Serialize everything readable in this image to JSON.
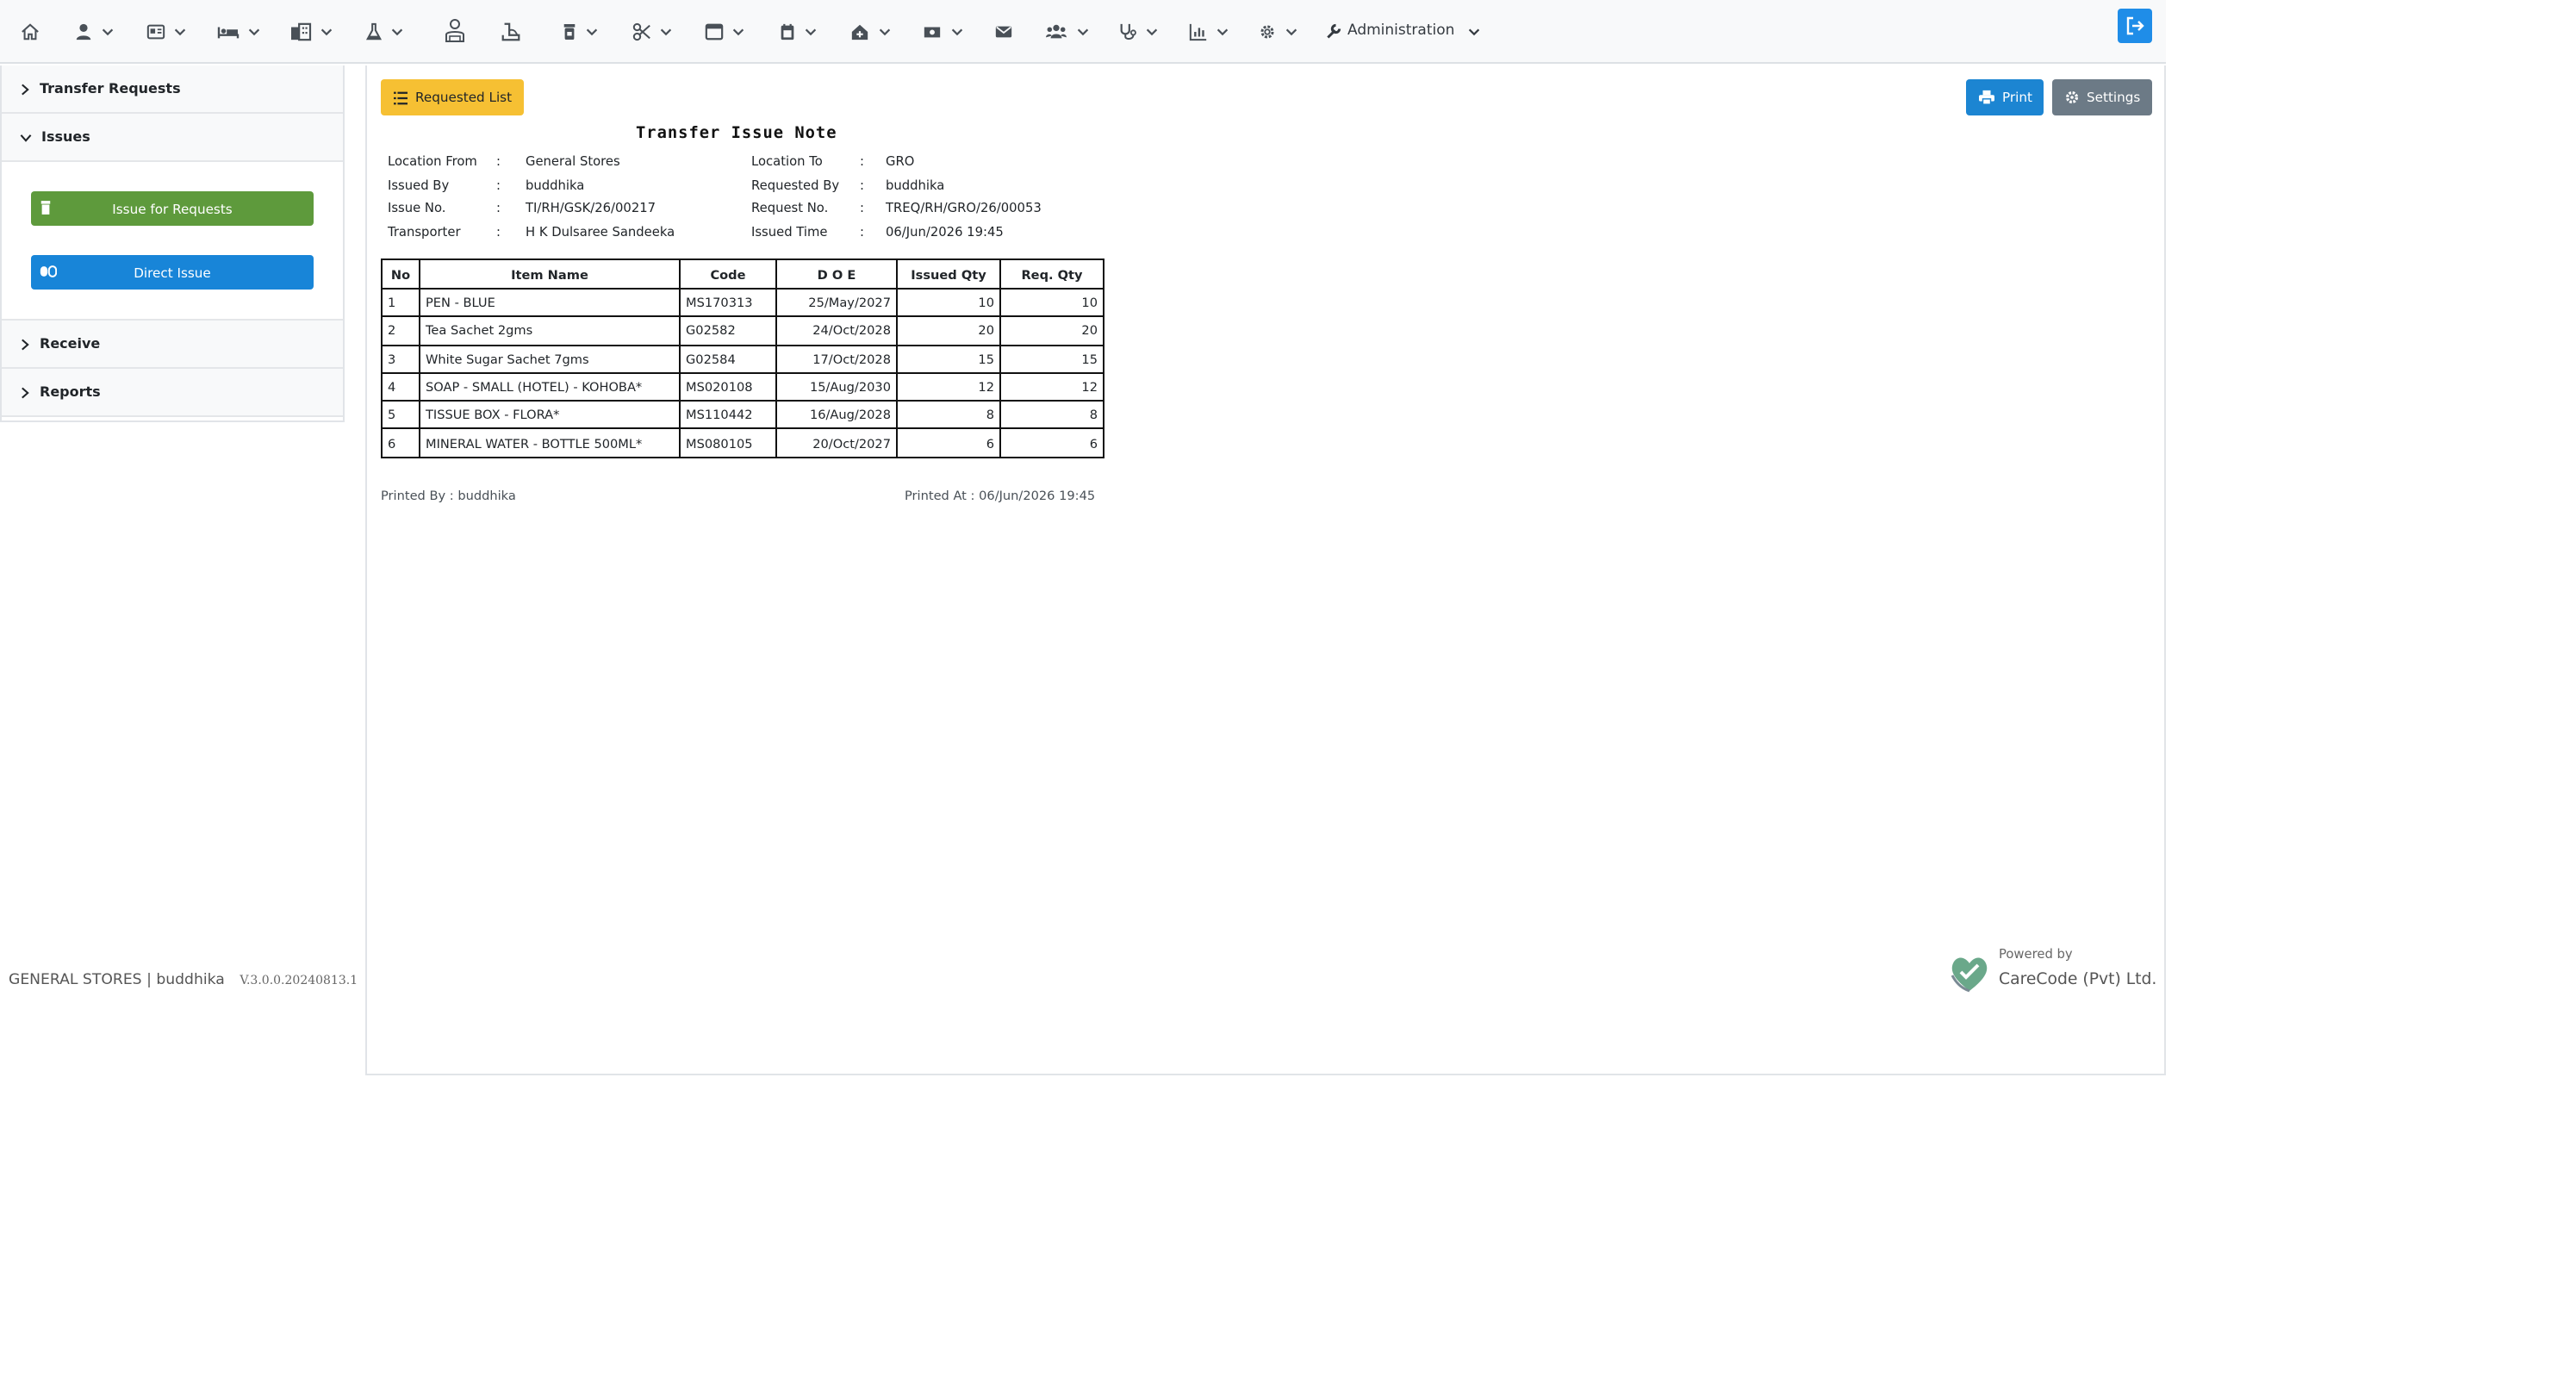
{
  "navbar": {
    "icons": [
      "home-icon",
      "user-icon",
      "id-card-icon",
      "bed-icon",
      "building-icon",
      "flask-icon",
      "doctor-icon",
      "pharmacy-icon",
      "pill-bottle-icon",
      "scissors-icon",
      "inbox-icon",
      "calendar-icon",
      "house-medical-icon",
      "cash-icon",
      "envelope-icon",
      "users-icon",
      "stethoscope-icon",
      "chart-icon",
      "gear-icon"
    ],
    "administration_label": "Administration",
    "logout_icon": "sign-out-icon"
  },
  "sidebar": {
    "sections": [
      {
        "label": "Transfer Requests",
        "expanded": false
      },
      {
        "label": "Issues",
        "expanded": true
      },
      {
        "label": "Receive",
        "expanded": false
      },
      {
        "label": "Reports",
        "expanded": false
      }
    ],
    "issue_for_requests_label": "Issue for Requests",
    "direct_issue_label": "Direct Issue",
    "colors": {
      "issue_for_requests": "#5e9a3c",
      "direct_issue": "#1885d8"
    }
  },
  "toolbar": {
    "requested_list_label": "Requested List",
    "print_label": "Print",
    "settings_label": "Settings"
  },
  "document": {
    "title": "Transfer Issue Note",
    "left_fields": [
      {
        "label": "Location From",
        "value": "General Stores"
      },
      {
        "label": "Issued By",
        "value": "buddhika"
      },
      {
        "label": "Issue No.",
        "value": "TI/RH/GSK/26/00217"
      },
      {
        "label": "Transporter",
        "value": "H K Dulsaree Sandeeka"
      }
    ],
    "right_fields": [
      {
        "label": "Location To",
        "value": "GRO"
      },
      {
        "label": "Requested By",
        "value": "buddhika"
      },
      {
        "label": "Request No.",
        "value": "TREQ/RH/GRO/26/00053"
      },
      {
        "label": "Issued Time",
        "value": "06/Jun/2026 19:45"
      }
    ],
    "colon": ":",
    "table": {
      "headers": [
        "No",
        "Item Name",
        "Code",
        "D O E",
        "Issued Qty",
        "Req. Qty"
      ],
      "rows": [
        [
          "1",
          "PEN - BLUE",
          "MS170313",
          "25/May/2027",
          "10",
          "10"
        ],
        [
          "2",
          "Tea Sachet 2gms",
          "G02582",
          "24/Oct/2028",
          "20",
          "20"
        ],
        [
          "3",
          "White Sugar Sachet 7gms",
          "G02584",
          "17/Oct/2028",
          "15",
          "15"
        ],
        [
          "4",
          "SOAP - SMALL (HOTEL) - KOHOBA*",
          "MS020108",
          "15/Aug/2030",
          "12",
          "12"
        ],
        [
          "5",
          "TISSUE BOX - FLORA*",
          "MS110442",
          "16/Aug/2028",
          "8",
          "8"
        ],
        [
          "6",
          "MINERAL WATER - BOTTLE 500ML*",
          "MS080105",
          "20/Oct/2027",
          "6",
          "6"
        ]
      ]
    },
    "printed_by_label": "Printed By :",
    "printed_by": "buddhika",
    "printed_at_label": "Printed At :",
    "printed_at": "06/Jun/2026 19:45"
  },
  "footer": {
    "department": "GENERAL STORES",
    "separator": "|",
    "user": "buddhika",
    "version": "V.3.0.0.20240813.1",
    "powered_by": "Powered by",
    "company": "CareCode (Pvt) Ltd."
  }
}
